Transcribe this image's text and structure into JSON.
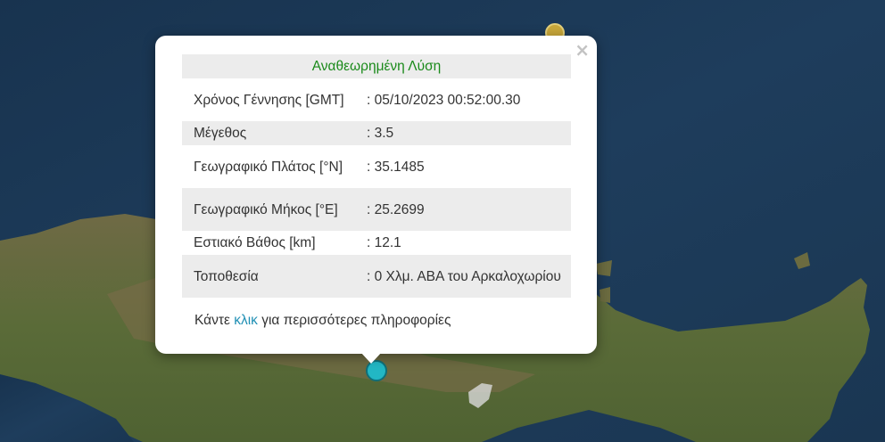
{
  "popup": {
    "title": "Αναθεωρημένη Λύση",
    "rows": [
      {
        "label": "Χρόνος Γέννησης [GMT]",
        "value": ": 05/10/2023 00:52:00.30"
      },
      {
        "label": "Μέγεθος",
        "value": ": 3.5"
      },
      {
        "label": "Γεωγραφικό Πλάτος [°N]",
        "value": ": 35.1485"
      },
      {
        "label": "Γεωγραφικό Μήκος [°E]",
        "value": ": 25.2699"
      },
      {
        "label": "Εστιακό Βάθος [km]",
        "value": ": 12.1"
      },
      {
        "label": "Τοποθεσία",
        "value": ": 0 Χλμ. ΑΒΑ του Αρκαλοχωρίου"
      }
    ],
    "footer": {
      "before": "Κάντε ",
      "link": "κλικ",
      "after": " για περισσότερες πληροφορίες"
    },
    "close_glyph": "×"
  },
  "markers": [
    {
      "name": "earthquake-marker-yellow",
      "color": "#c9a83a"
    },
    {
      "name": "earthquake-marker-selected",
      "color": "#22b7c4"
    }
  ],
  "colors": {
    "sea": "#1c3a57",
    "land": "#5f6d3a",
    "title": "#1a8a1a",
    "link": "#1f8fb4"
  }
}
